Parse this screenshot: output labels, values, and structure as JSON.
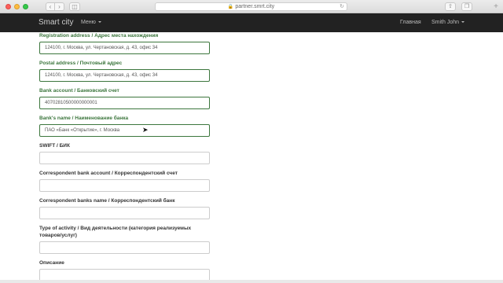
{
  "browser": {
    "url": "partner.smrt.city"
  },
  "navbar": {
    "brand": "Smart city",
    "menu_label": "Меню",
    "home_label": "Главная",
    "user_label": "Smith John"
  },
  "form": {
    "registration_address": {
      "label": "Registration address / Адрес места нахождения",
      "value": "124100, г. Москва, ул. Чертановская, д. 43, офис 34"
    },
    "postal_address": {
      "label": "Postal address / Почтовый адрес",
      "value": "124100, г. Москва, ул. Чертановская, д. 43, офис 34"
    },
    "bank_account": {
      "label": "Bank account / Банковский счет",
      "value": "40702810500000000001"
    },
    "bank_name": {
      "label": "Bank's name / Наименование банка",
      "value": "ПАО «Банк «Открытие», г. Москва"
    },
    "swift": {
      "label": "SWIFT / БИК",
      "value": ""
    },
    "correspondent_account": {
      "label": "Correspondent bank account / Корреспондентский счет",
      "value": ""
    },
    "correspondent_bank_name": {
      "label": "Correspondent banks name / Корреспондентский банк",
      "value": ""
    },
    "activity_type": {
      "label": "Type of activity / Вид деятельности (категория реализуемых товаров/услуг)",
      "value": ""
    },
    "description": {
      "label": "Описание",
      "value": ""
    }
  }
}
